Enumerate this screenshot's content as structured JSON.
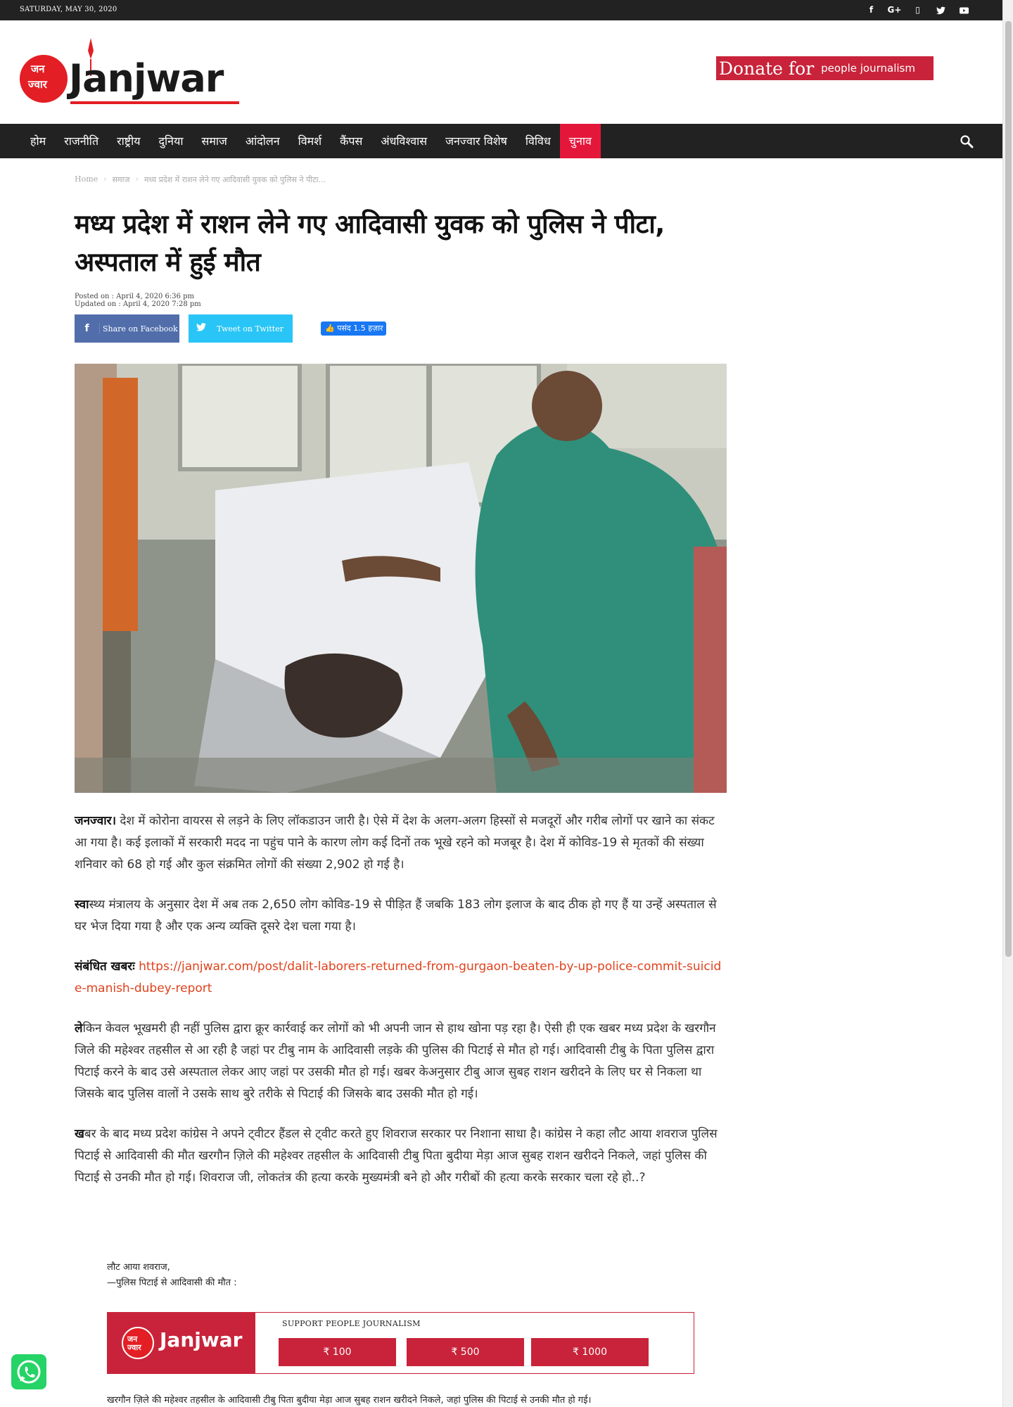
{
  "topbar": {
    "date": "SATURDAY, MAY 30, 2020",
    "social_icons": [
      "facebook-icon",
      "google-plus-icon",
      "instagram-icon",
      "twitter-icon",
      "youtube-icon"
    ],
    "social_glyphs": [
      "f",
      "G+",
      "▯",
      "t",
      "▶"
    ]
  },
  "brand": {
    "logo_line1": "जन",
    "logo_line2": "ज्वार",
    "wordmark": "Janjwar",
    "accent": "#e31e24"
  },
  "donate": {
    "big": "Donate for",
    "small": "people journalism"
  },
  "nav": {
    "items": [
      "होम",
      "राजनीति",
      "राष्ट्रीय",
      "दुनिया",
      "समाज",
      "आंदोलन",
      "विमर्श",
      "कैंपस",
      "अंधविश्वास",
      "जनज्वार विशेष",
      "विविध",
      "चुनाव"
    ],
    "active_index": 11,
    "active_color": "#e4173b"
  },
  "breadcrumb": {
    "home": "Home",
    "category": "समाज",
    "current": "मध्य प्रदेश में राशन लेने गए आदिवासी युवक को पुलिस ने पीटा..."
  },
  "article": {
    "title": "मध्य प्रदेश में राशन लेने गए आदिवासी युवक को पुलिस ने पीटा, अस्पताल में हुई मौत",
    "posted": "Posted on : April 4, 2020 6:36 pm",
    "updated": "Updated on : April 4, 2020 7:28 pm",
    "share_facebook": "Share on Facebook",
    "share_twitter": "Tweet on Twitter",
    "like_label": "👍 पसंद 1.5 हज़ार",
    "p1_lead": "जनज्वार।",
    "p1": " देश में कोरोना वायरस से लड़ने के लिए लॉकडाउन जारी है। ऐसे में देश के अलग-अलग हिस्सों से मजदूरों और गरीब लोगों पर खाने का संकट आ गया है। कई इलाकों में सरकारी मदद ना पहुंच पाने के कारण लोग कई दिनों तक भूखे रहने को मजबूर है। देश में कोविड-19 से मृतकों की संख्या शनिवार को 68 हो गई और कुल संक्रमित लोगों की संख्या 2,902 हो गई है।",
    "p2_lead": "स्वा",
    "p2": "स्थ्य मंत्रालय के अनुसार देश में अब तक 2,650 लोग कोविड-19 से पीड़ित हैं जबकि 183 लोग इलाज के बाद ठीक हो गए हैं या उन्हें अस्पताल से घर भेज दिया गया है और एक अन्य व्यक्ति दूसरे देश चला गया है।",
    "related_label": "संबंधित खबरः",
    "related_link": "https://janjwar.com/post/dalit-laborers-returned-from-gurgaon-beaten-by-up-police-commit-suicide-manish-dubey-report",
    "p3_lead": "ले",
    "p3": "किन केवल भूखमरी ही नहीं पुलिस द्वारा क्रूर कार्रवाई कर लोगों को भी अपनी जान से हाथ खोना पड़ रहा है। ऐसी ही एक खबर मध्य प्रदेश के खरगौन जिले की महेश्वर तहसील से आ रही है जहां पर टीबु नाम के आदिवासी लड़के की पुलिस की पिटाई से मौत हो गई। आदिवासी टीबु के पिता पुलिस द्वारा पिटाई करने के बाद उसे अस्पताल लेकर आए  जहां पर उसकी मौत हो गई।  खबर केअनुसार टीबु आज सुबह राशन खरीदने के लिए घर से निकला था जिसके बाद पुलिस वालों ने उसके साथ बुरे तरीके से पिटाई की जिसके बाद उसकी मौत हो गई।",
    "p4_lead": "ख",
    "p4": "बर के बाद मध्य प्रदेश कांग्रेस ने अपने ट्वीटर हैंडल से ट्वीट करते हुए  शिवराज सरकार पर निशाना साधा है। कांग्रेस ने कहा लौट आया शवराज पुलिस पिटाई से आदिवासी की मौत  खरगौन ज़िले की महेश्वर तहसील के आदिवासी टीबु पिता बुदीया मेड़ा आज सुबह राशन खरीदने निकले, जहां पुलिस की पिटाई से उनकी मौत हो गई। शिवराज जी, लोकतंत्र की हत्या करके मुख्यमंत्री बने हो और गरीबों की हत्या करके सरकार चला रहे हो..?",
    "quote_line1": "लौट आया शवराज,",
    "quote_line2": "—पुलिस पिटाई से आदिवासी की मौत :",
    "bottom_line": "खरगौन ज़िले की महेश्वर तहसील के आदिवासी टीबु पिता बुदीया मेड़ा आज सुबह राशन खरीदने निकले, जहां पुलिस की पिटाई से उनकी मौत हो गई।"
  },
  "support": {
    "logo_text": "जन ज्वार",
    "wordmark": "Janjwar",
    "heading": "SUPPORT PEOPLE JOURNALISM",
    "amounts": [
      "₹ 100",
      "₹ 500",
      "₹ 1000"
    ],
    "color": "#c8233a"
  }
}
